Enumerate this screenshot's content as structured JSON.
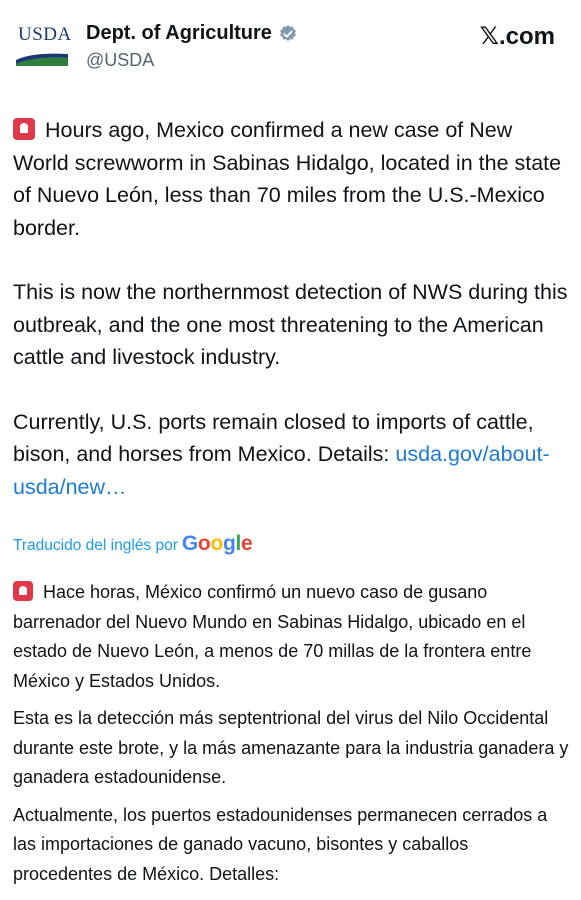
{
  "header": {
    "logo_text": "USDA",
    "display_name": "Dept. of Agriculture",
    "handle": "@USDA",
    "site": ".com",
    "verified_icon": "verified-badge-icon"
  },
  "tweet": {
    "p1": "Hours ago, Mexico confirmed a new case of New World screwworm in Sabinas Hidalgo, located in the state of Nuevo León, less than 70 miles from the U.S.-Mexico border.",
    "p2": "This is now the northernmost detection of NWS during this outbreak, and the one most threatening to the American cattle and livestock industry.",
    "p3": "Currently, U.S. ports remain closed to imports of cattle, bison, and horses from Mexico. Details:",
    "link": "usda.gov/about-usda/new…"
  },
  "translation": {
    "label": "Traducido del inglés por",
    "provider": "Google",
    "p1": "Hace horas, México confirmó un nuevo caso de gusano barrenador del Nuevo Mundo en Sabinas Hidalgo, ubicado en el estado de Nuevo León, a menos de 70 millas de la frontera entre México y Estados Unidos.",
    "p2": "Esta es la detección más septentrional del virus del Nilo Occidental durante este brote, y la más amenazante para la industria ganadera y ganadera estadounidense.",
    "p3": "Actualmente, los puertos estadounidenses permanecen cerrados a las importaciones de ganado vacuno, bisontes y caballos procedentes de México. Detalles:"
  },
  "colors": {
    "link": "#1d7bd8",
    "translate_label": "#1d9bf0",
    "usda_blue": "#1b3a73",
    "usda_green": "#2e7d3a"
  }
}
